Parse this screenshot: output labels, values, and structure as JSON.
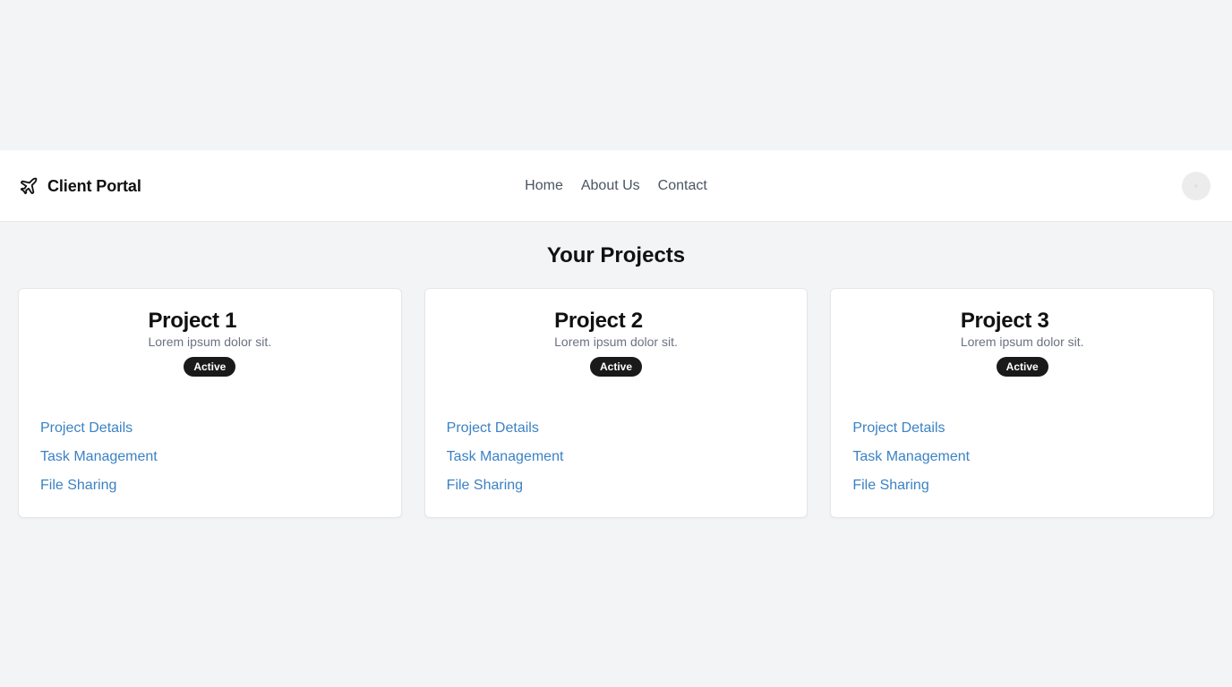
{
  "header": {
    "brand": "Client Portal",
    "brand_icon": "plane-icon",
    "nav": [
      "Home",
      "About Us",
      "Contact"
    ]
  },
  "main": {
    "title": "Your Projects",
    "projects": [
      {
        "title": "Project 1",
        "description": "Lorem ipsum dolor sit.",
        "status": "Active",
        "links": [
          "Project Details",
          "Task Management",
          "File Sharing"
        ]
      },
      {
        "title": "Project 2",
        "description": "Lorem ipsum dolor sit.",
        "status": "Active",
        "links": [
          "Project Details",
          "Task Management",
          "File Sharing"
        ]
      },
      {
        "title": "Project 3",
        "description": "Lorem ipsum dolor sit.",
        "status": "Active",
        "links": [
          "Project Details",
          "Task Management",
          "File Sharing"
        ]
      }
    ]
  },
  "colors": {
    "background": "#f3f4f6",
    "link": "#3b82c4",
    "badge": "#1a1a1a"
  }
}
